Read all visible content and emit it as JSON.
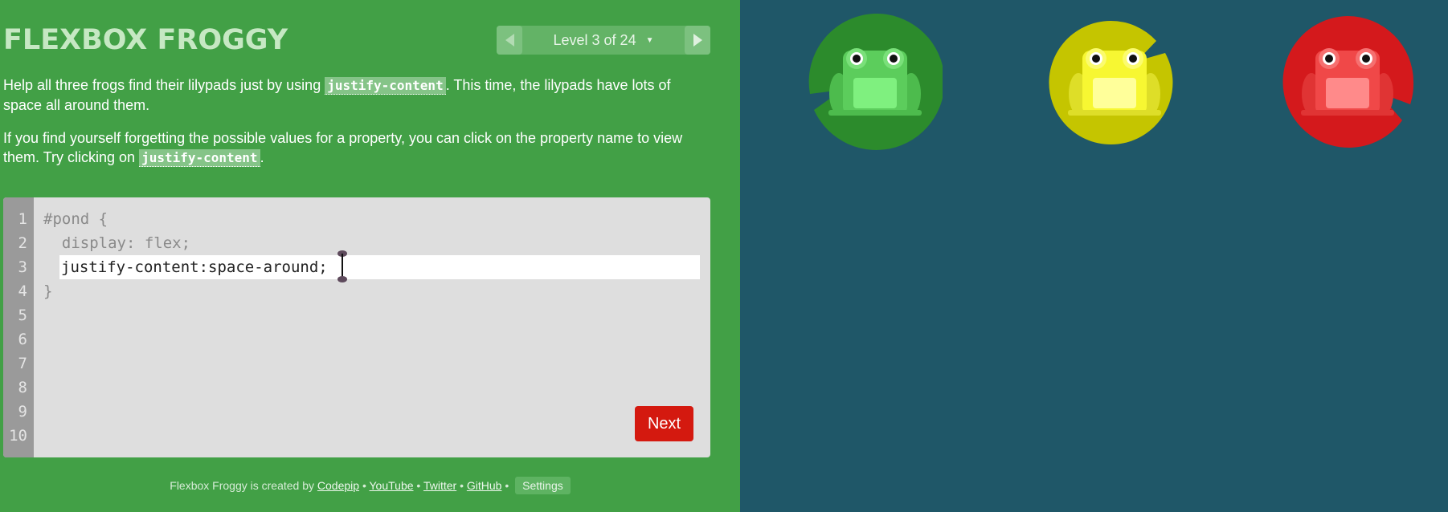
{
  "header": {
    "title": "FLEXBOX FROGGY",
    "level_label": "Level 3 of 24"
  },
  "instructions": {
    "p1": {
      "before": "Help all three frogs find their lilypads just by using ",
      "code": "justify-content",
      "after": ". This time, the lilypads have lots of space all around them."
    },
    "p2": {
      "before": "If you find yourself forgetting the possible values for a property, you can click on the property name to view them. Try clicking on ",
      "code": "justify-content",
      "after": "."
    }
  },
  "editor": {
    "line_numbers": [
      "1",
      "2",
      "3",
      "4",
      "5",
      "6",
      "7",
      "8",
      "9",
      "10"
    ],
    "line1": "#pond {",
    "line2": "  display: flex;",
    "input_value": "justify-content:space-around;",
    "line4": "}",
    "next_label": "Next"
  },
  "footer": {
    "prefix": "Flexbox Froggy is created by",
    "links": [
      "Codepip",
      "YouTube",
      "Twitter",
      "GitHub"
    ],
    "separator": "•",
    "settings_label": "Settings"
  },
  "pond": {
    "frogs": [
      {
        "color": "green",
        "pad_color": "#2c8b2c",
        "body_color": "#5ccd5c"
      },
      {
        "color": "yellow",
        "pad_color": "#c5c500",
        "body_color": "#f7f732"
      },
      {
        "color": "red",
        "pad_color": "#d4191c",
        "body_color": "#f04848"
      }
    ],
    "background": "#1f5768"
  }
}
